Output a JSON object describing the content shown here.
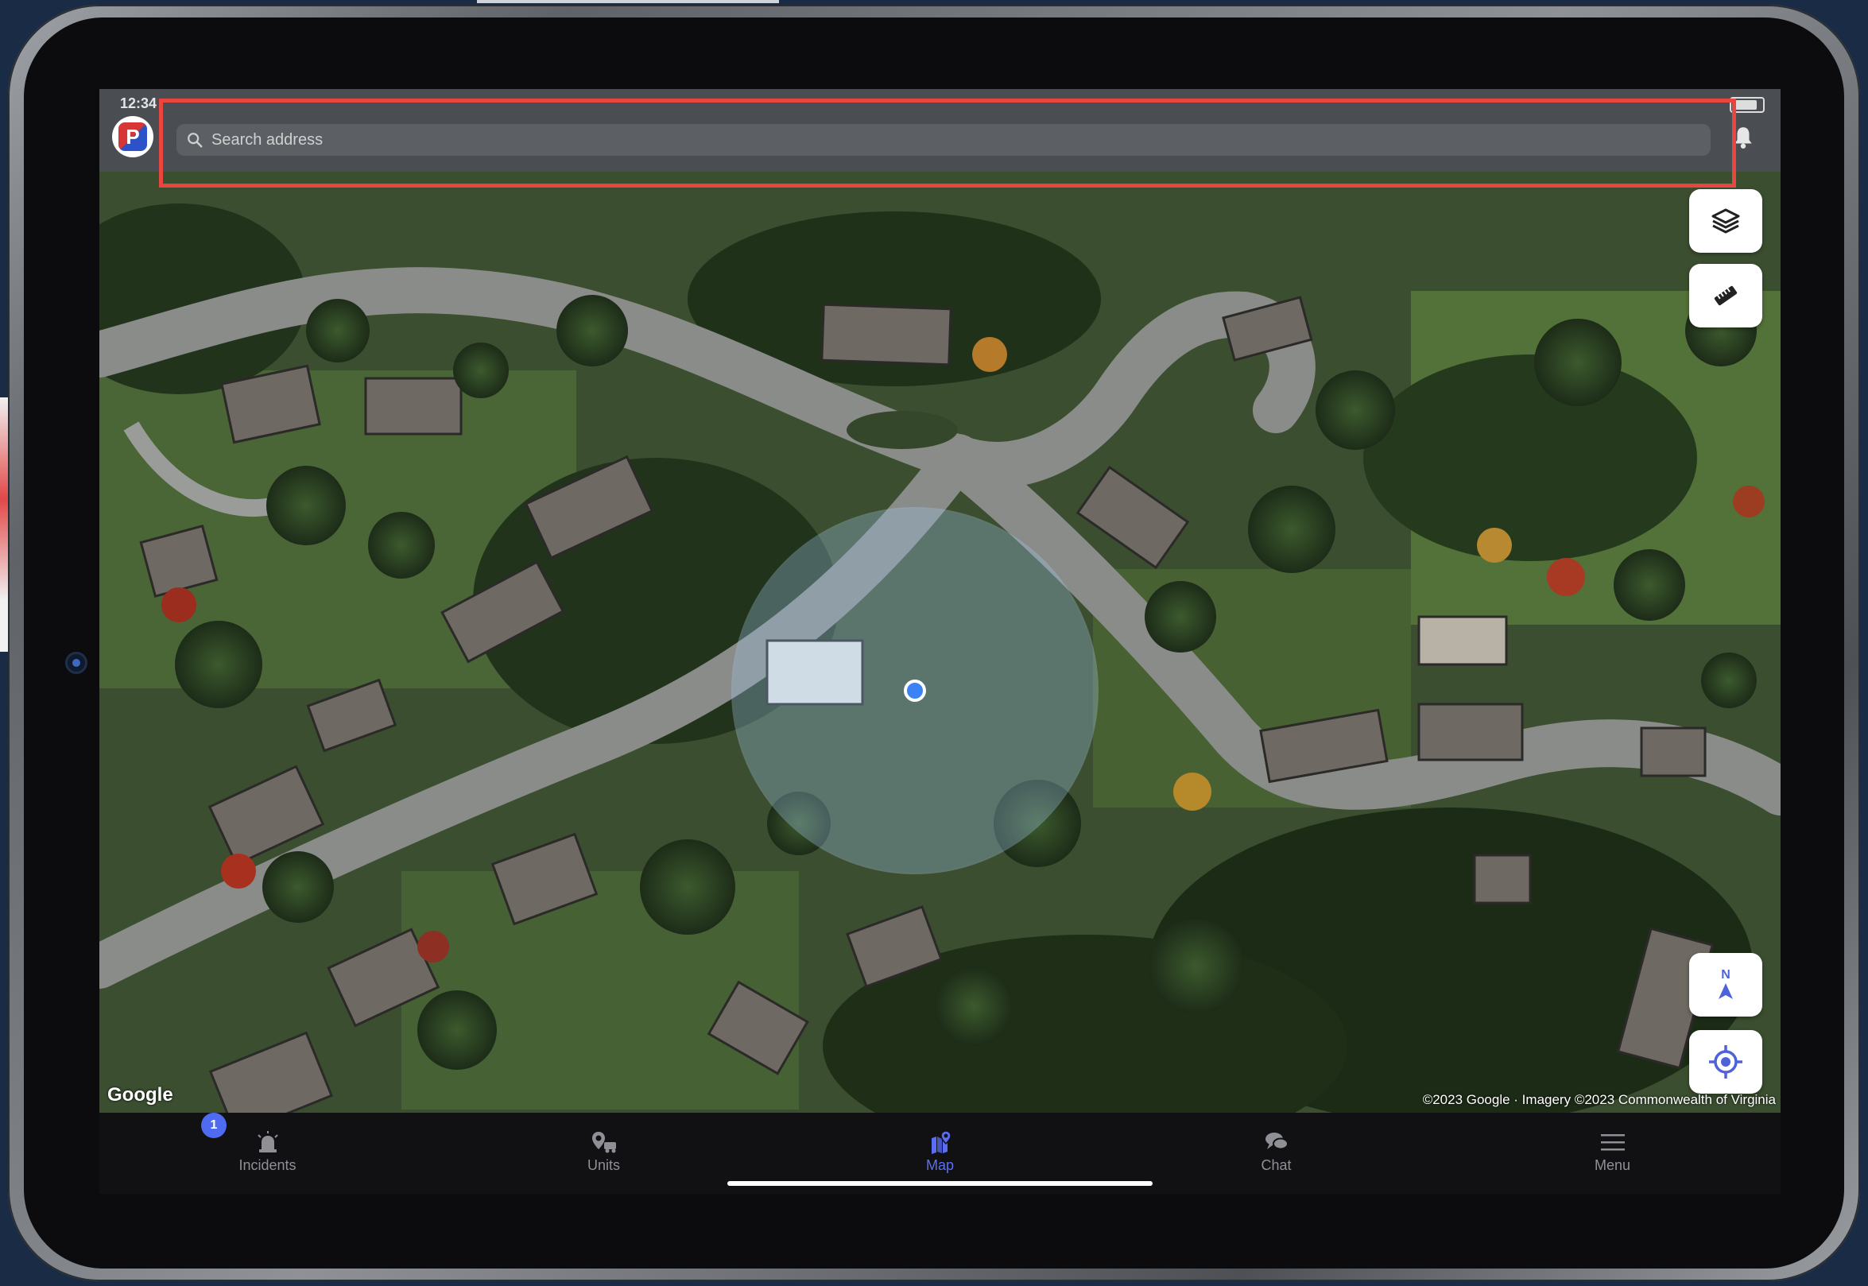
{
  "status": {
    "time": "12:34"
  },
  "header": {
    "search_placeholder": "Search address"
  },
  "map": {
    "attribution_logo": "Google",
    "copyright": "©2023 Google · Imagery ©2023 Commonwealth of Virginia",
    "compass_label": "N"
  },
  "tabs": [
    {
      "label": "Incidents",
      "badge": "1",
      "icon": "siren-icon"
    },
    {
      "label": "Units",
      "icon": "units-icon"
    },
    {
      "label": "Map",
      "icon": "map-pin-icon",
      "active": true
    },
    {
      "label": "Chat",
      "icon": "chat-icon"
    },
    {
      "label": "Menu",
      "icon": "hamburger-icon"
    }
  ],
  "colors": {
    "accent": "#5a6ef5",
    "highlight": "#e9463f",
    "tabbar": "#111114",
    "header": "#4a4d52"
  }
}
